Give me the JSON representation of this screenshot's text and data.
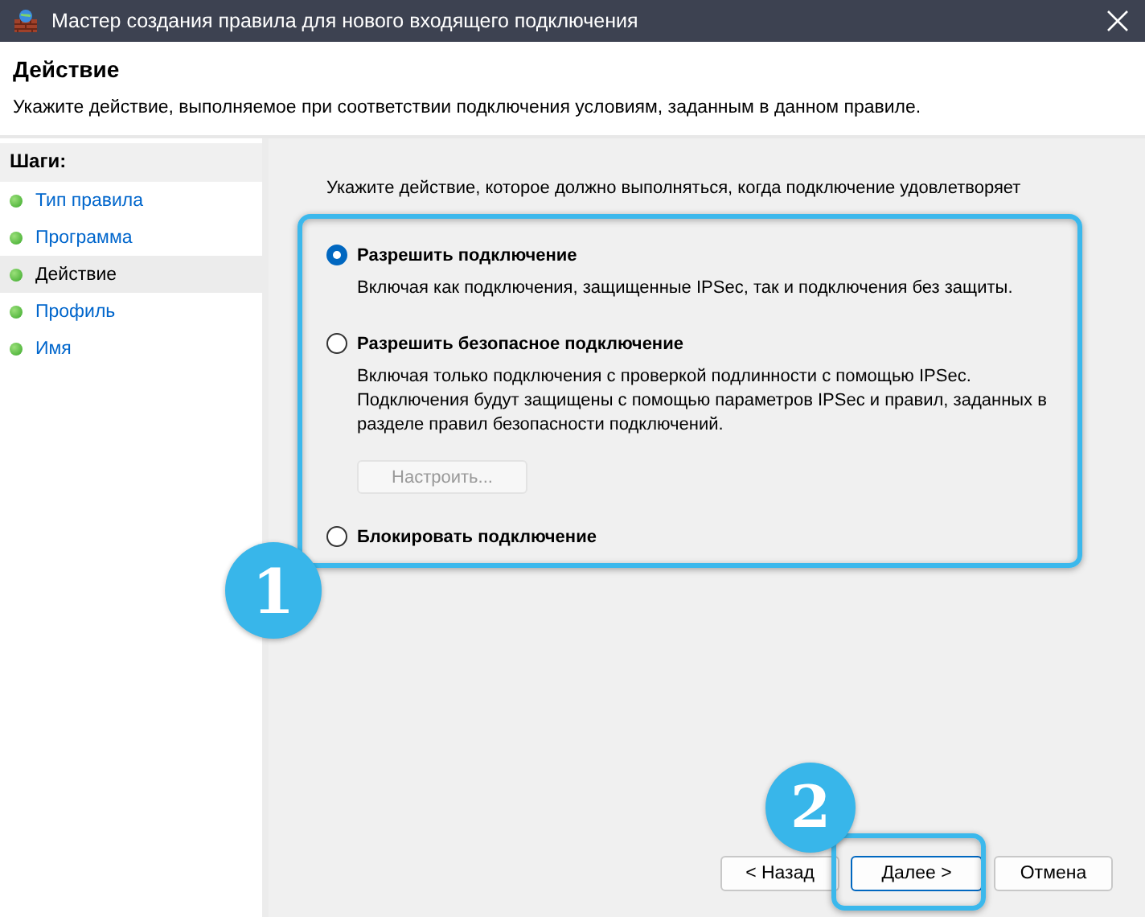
{
  "window": {
    "title": "Мастер создания правила для нового входящего подключения"
  },
  "header": {
    "title": "Действие",
    "description": "Укажите действие, выполняемое при соответствии подключения условиям, заданным в данном правиле."
  },
  "steps": {
    "heading": "Шаги:",
    "items": [
      {
        "label": "Тип правила",
        "selected": false
      },
      {
        "label": "Программа",
        "selected": false
      },
      {
        "label": "Действие",
        "selected": true
      },
      {
        "label": "Профиль",
        "selected": false
      },
      {
        "label": "Имя",
        "selected": false
      }
    ]
  },
  "intro": "Укажите действие, которое должно выполняться, когда подключение удовлетворяет",
  "options": [
    {
      "label": "Разрешить подключение",
      "selected": true,
      "description": "Включая как подключения, защищенные IPSec, так и подключения без защиты."
    },
    {
      "label": "Разрешить безопасное подключение",
      "selected": false,
      "description": "Включая только подключения с проверкой подлинности с помощью IPSec. Подключения будут защищены с помощью параметров IPSec и правил, заданных в разделе правил безопасности подключений.",
      "button": {
        "label": "Настроить...",
        "disabled": true
      }
    },
    {
      "label": "Блокировать подключение",
      "selected": false
    }
  ],
  "buttons": [
    {
      "label": "< Назад",
      "default": false
    },
    {
      "label": "Далее >",
      "default": true
    },
    {
      "label": "Отмена",
      "default": false
    }
  ],
  "annotations": [
    {
      "label": "1"
    },
    {
      "label": "2"
    }
  ]
}
